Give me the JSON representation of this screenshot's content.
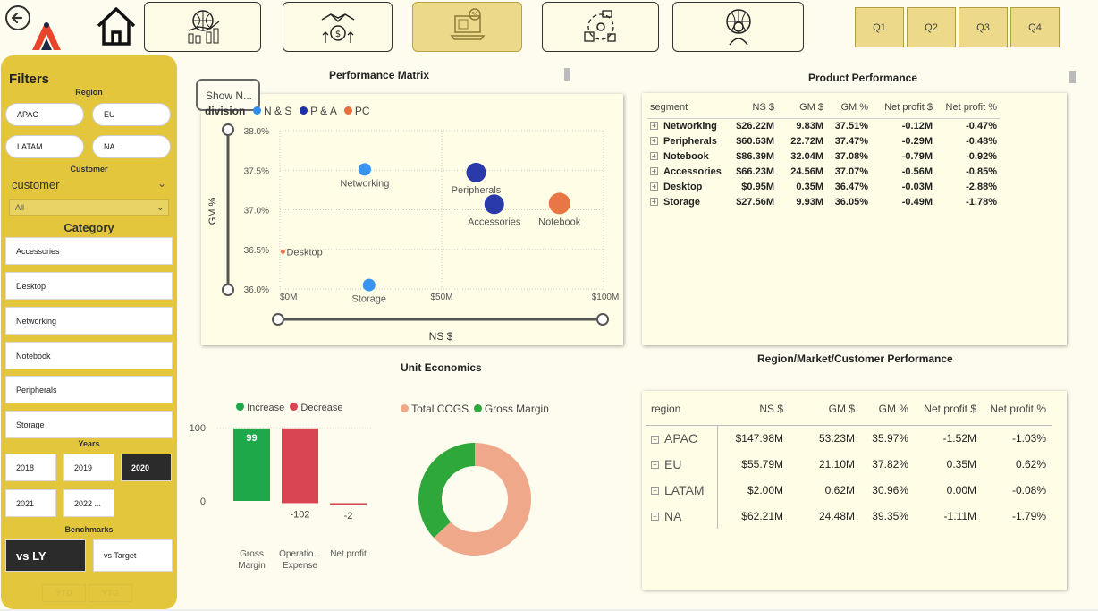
{
  "nav": {
    "back_icon": "circle-arrow-left-icon",
    "logo": "atliq-logo",
    "home_icon": "home-icon",
    "pages": [
      {
        "icon": "finance-globe-chart-icon"
      },
      {
        "icon": "sales-handshake-coins-icon"
      },
      {
        "icon": "marketing-laptop-percent-icon",
        "active": true
      },
      {
        "icon": "supply-chain-truck-icon"
      },
      {
        "icon": "executive-globe-person-icon"
      }
    ],
    "quarters": [
      "Q1",
      "Q2",
      "Q3",
      "Q4"
    ]
  },
  "sidebar": {
    "title": "Filters",
    "region_label": "Region",
    "regions": [
      "APAC",
      "EU",
      "LATAM",
      "NA"
    ],
    "customer_label": "Customer",
    "customer_dropdown_label": "customer",
    "customer_value": "All",
    "category_label": "Category",
    "categories": [
      "Accessories",
      "Desktop",
      "Networking",
      "Notebook",
      "Peripherals",
      "Storage"
    ],
    "years_label": "Years",
    "years": [
      "2018",
      "2019",
      "2020",
      "2021",
      "2022 ..."
    ],
    "selected_year": "2020",
    "benchmarks_label": "Benchmarks",
    "benchmarks": [
      "vs LY",
      "vs Target"
    ],
    "ytd_label": "YTD",
    "ytg_label": "YTG"
  },
  "performance_matrix": {
    "title": "Performance Matrix",
    "show_button": "Show N...",
    "legend_title": "division",
    "chart_data": {
      "type": "scatter",
      "xlabel": "NS $",
      "ylabel": "GM %",
      "xlim": [
        0,
        100
      ],
      "ylim": [
        36.0,
        38.0
      ],
      "x_ticks": [
        "$0M",
        "$50M",
        "$100M"
      ],
      "y_ticks": [
        "38.0%",
        "37.5%",
        "37.0%",
        "36.5%",
        "36.0%"
      ],
      "series": [
        {
          "name": "N & S",
          "color": "#2d8ef0",
          "points": [
            {
              "label": "Networking",
              "x": 26.22,
              "y": 37.51
            },
            {
              "label": "Storage",
              "x": 27.56,
              "y": 36.05
            }
          ]
        },
        {
          "name": "P & A",
          "color": "#1f2fa6",
          "points": [
            {
              "label": "Peripherals",
              "x": 60.63,
              "y": 37.47
            },
            {
              "label": "Accessories",
              "x": 66.23,
              "y": 37.07
            }
          ]
        },
        {
          "name": "PC",
          "color": "#e8703c",
          "points": [
            {
              "label": "Notebook",
              "x": 86.39,
              "y": 37.08
            },
            {
              "label": "Desktop",
              "x": 0.95,
              "y": 36.47
            }
          ]
        }
      ]
    }
  },
  "product_performance": {
    "title": "Product Performance",
    "columns": [
      "segment",
      "NS $",
      "GM $",
      "GM %",
      "Net profit $",
      "Net profit %"
    ],
    "rows": [
      [
        "Networking",
        "$26.22M",
        "9.83M",
        "37.51%",
        "-0.12M",
        "-0.47%"
      ],
      [
        "Peripherals",
        "$60.63M",
        "22.72M",
        "37.47%",
        "-0.29M",
        "-0.48%"
      ],
      [
        "Notebook",
        "$86.39M",
        "32.04M",
        "37.08%",
        "-0.79M",
        "-0.92%"
      ],
      [
        "Accessories",
        "$66.23M",
        "24.56M",
        "37.07%",
        "-0.56M",
        "-0.85%"
      ],
      [
        "Desktop",
        "$0.95M",
        "0.35M",
        "36.47%",
        "-0.03M",
        "-2.88%"
      ],
      [
        "Storage",
        "$27.56M",
        "9.93M",
        "36.05%",
        "-0.49M",
        "-1.78%"
      ]
    ]
  },
  "unit_economics": {
    "title": "Unit Economics",
    "chart_data": [
      {
        "type": "bar",
        "legend": [
          {
            "name": "Increase",
            "color": "#1fa84a"
          },
          {
            "name": "Decrease",
            "color": "#d94452"
          }
        ],
        "categories": [
          "Gross\nMargin",
          "Operatio...\nExpense",
          "Net profit"
        ],
        "values": [
          99,
          -102,
          -2
        ],
        "data_labels": [
          "99",
          "-102",
          "-2"
        ],
        "y_ticks": [
          "100",
          "0"
        ],
        "ylim": [
          0,
          100
        ]
      },
      {
        "type": "pie",
        "legend": [
          {
            "name": "Total COGS",
            "color": "#f0a88a"
          },
          {
            "name": "Gross Margin",
            "color": "#2ea83a"
          }
        ],
        "values": [
          63,
          37
        ]
      }
    ]
  },
  "region_performance": {
    "title": "Region/Market/Customer Performance",
    "columns": [
      "region",
      "NS $",
      "GM $",
      "GM %",
      "Net profit $",
      "Net profit %"
    ],
    "rows": [
      [
        "APAC",
        "$147.98M",
        "53.23M",
        "35.97%",
        "-1.52M",
        "-1.03%"
      ],
      [
        "EU",
        "$55.79M",
        "21.10M",
        "37.82%",
        "0.35M",
        "0.62%"
      ],
      [
        "LATAM",
        "$2.00M",
        "0.62M",
        "30.96%",
        "0.00M",
        "-0.08%"
      ],
      [
        "NA",
        "$62.21M",
        "24.48M",
        "39.35%",
        "-1.11M",
        "-1.79%"
      ]
    ]
  }
}
